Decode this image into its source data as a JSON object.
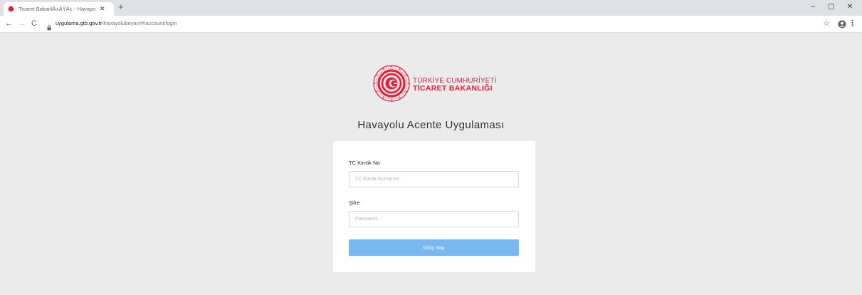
{
  "browser": {
    "tab_title": "Ticaret BakanlÄ±ÄŸÄ± - Havayo",
    "tab_close_glyph": "✕",
    "new_tab_glyph": "+",
    "url_host": "uygulama.gtb.gov.tr",
    "url_path": "/havayolubeyan/#/account/login",
    "back_glyph": "←",
    "forward_glyph": "→",
    "reload_glyph": "C",
    "star_glyph": "☆",
    "menu_glyph": "⋮",
    "minimize_glyph": "–",
    "maximize_glyph": "▢",
    "close_glyph": "✕"
  },
  "logo": {
    "line1": "TÜRKİYE CUMHURİYETİ",
    "line2": "TİCARET BAKANLIĞI",
    "color": "#e3223a"
  },
  "app": {
    "title": "Havayolu Acente Uygulaması"
  },
  "login": {
    "tc_label": "TC Kimlik No",
    "tc_placeholder": "TC Kimlik Numarası",
    "password_label": "Şifre",
    "password_placeholder": "Password",
    "submit_label": "Giriş Yap",
    "submit_color": "#7ab8f0"
  }
}
